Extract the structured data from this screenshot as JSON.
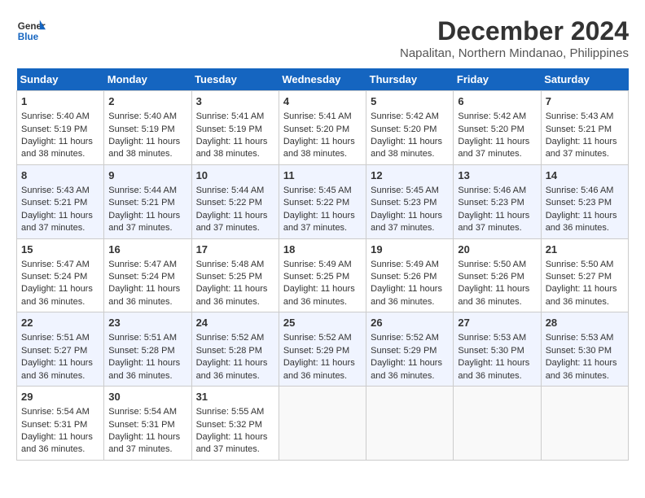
{
  "app": {
    "name": "GeneralBlue",
    "logo_text_line1": "General",
    "logo_text_line2": "Blue"
  },
  "header": {
    "month_year": "December 2024",
    "location": "Napalitan, Northern Mindanao, Philippines"
  },
  "days_of_week": [
    "Sunday",
    "Monday",
    "Tuesday",
    "Wednesday",
    "Thursday",
    "Friday",
    "Saturday"
  ],
  "weeks": [
    [
      {
        "day": "1",
        "sunrise": "Sunrise: 5:40 AM",
        "sunset": "Sunset: 5:19 PM",
        "daylight": "Daylight: 11 hours and 38 minutes."
      },
      {
        "day": "2",
        "sunrise": "Sunrise: 5:40 AM",
        "sunset": "Sunset: 5:19 PM",
        "daylight": "Daylight: 11 hours and 38 minutes."
      },
      {
        "day": "3",
        "sunrise": "Sunrise: 5:41 AM",
        "sunset": "Sunset: 5:19 PM",
        "daylight": "Daylight: 11 hours and 38 minutes."
      },
      {
        "day": "4",
        "sunrise": "Sunrise: 5:41 AM",
        "sunset": "Sunset: 5:20 PM",
        "daylight": "Daylight: 11 hours and 38 minutes."
      },
      {
        "day": "5",
        "sunrise": "Sunrise: 5:42 AM",
        "sunset": "Sunset: 5:20 PM",
        "daylight": "Daylight: 11 hours and 38 minutes."
      },
      {
        "day": "6",
        "sunrise": "Sunrise: 5:42 AM",
        "sunset": "Sunset: 5:20 PM",
        "daylight": "Daylight: 11 hours and 37 minutes."
      },
      {
        "day": "7",
        "sunrise": "Sunrise: 5:43 AM",
        "sunset": "Sunset: 5:21 PM",
        "daylight": "Daylight: 11 hours and 37 minutes."
      }
    ],
    [
      {
        "day": "8",
        "sunrise": "Sunrise: 5:43 AM",
        "sunset": "Sunset: 5:21 PM",
        "daylight": "Daylight: 11 hours and 37 minutes."
      },
      {
        "day": "9",
        "sunrise": "Sunrise: 5:44 AM",
        "sunset": "Sunset: 5:21 PM",
        "daylight": "Daylight: 11 hours and 37 minutes."
      },
      {
        "day": "10",
        "sunrise": "Sunrise: 5:44 AM",
        "sunset": "Sunset: 5:22 PM",
        "daylight": "Daylight: 11 hours and 37 minutes."
      },
      {
        "day": "11",
        "sunrise": "Sunrise: 5:45 AM",
        "sunset": "Sunset: 5:22 PM",
        "daylight": "Daylight: 11 hours and 37 minutes."
      },
      {
        "day": "12",
        "sunrise": "Sunrise: 5:45 AM",
        "sunset": "Sunset: 5:23 PM",
        "daylight": "Daylight: 11 hours and 37 minutes."
      },
      {
        "day": "13",
        "sunrise": "Sunrise: 5:46 AM",
        "sunset": "Sunset: 5:23 PM",
        "daylight": "Daylight: 11 hours and 37 minutes."
      },
      {
        "day": "14",
        "sunrise": "Sunrise: 5:46 AM",
        "sunset": "Sunset: 5:23 PM",
        "daylight": "Daylight: 11 hours and 36 minutes."
      }
    ],
    [
      {
        "day": "15",
        "sunrise": "Sunrise: 5:47 AM",
        "sunset": "Sunset: 5:24 PM",
        "daylight": "Daylight: 11 hours and 36 minutes."
      },
      {
        "day": "16",
        "sunrise": "Sunrise: 5:47 AM",
        "sunset": "Sunset: 5:24 PM",
        "daylight": "Daylight: 11 hours and 36 minutes."
      },
      {
        "day": "17",
        "sunrise": "Sunrise: 5:48 AM",
        "sunset": "Sunset: 5:25 PM",
        "daylight": "Daylight: 11 hours and 36 minutes."
      },
      {
        "day": "18",
        "sunrise": "Sunrise: 5:49 AM",
        "sunset": "Sunset: 5:25 PM",
        "daylight": "Daylight: 11 hours and 36 minutes."
      },
      {
        "day": "19",
        "sunrise": "Sunrise: 5:49 AM",
        "sunset": "Sunset: 5:26 PM",
        "daylight": "Daylight: 11 hours and 36 minutes."
      },
      {
        "day": "20",
        "sunrise": "Sunrise: 5:50 AM",
        "sunset": "Sunset: 5:26 PM",
        "daylight": "Daylight: 11 hours and 36 minutes."
      },
      {
        "day": "21",
        "sunrise": "Sunrise: 5:50 AM",
        "sunset": "Sunset: 5:27 PM",
        "daylight": "Daylight: 11 hours and 36 minutes."
      }
    ],
    [
      {
        "day": "22",
        "sunrise": "Sunrise: 5:51 AM",
        "sunset": "Sunset: 5:27 PM",
        "daylight": "Daylight: 11 hours and 36 minutes."
      },
      {
        "day": "23",
        "sunrise": "Sunrise: 5:51 AM",
        "sunset": "Sunset: 5:28 PM",
        "daylight": "Daylight: 11 hours and 36 minutes."
      },
      {
        "day": "24",
        "sunrise": "Sunrise: 5:52 AM",
        "sunset": "Sunset: 5:28 PM",
        "daylight": "Daylight: 11 hours and 36 minutes."
      },
      {
        "day": "25",
        "sunrise": "Sunrise: 5:52 AM",
        "sunset": "Sunset: 5:29 PM",
        "daylight": "Daylight: 11 hours and 36 minutes."
      },
      {
        "day": "26",
        "sunrise": "Sunrise: 5:52 AM",
        "sunset": "Sunset: 5:29 PM",
        "daylight": "Daylight: 11 hours and 36 minutes."
      },
      {
        "day": "27",
        "sunrise": "Sunrise: 5:53 AM",
        "sunset": "Sunset: 5:30 PM",
        "daylight": "Daylight: 11 hours and 36 minutes."
      },
      {
        "day": "28",
        "sunrise": "Sunrise: 5:53 AM",
        "sunset": "Sunset: 5:30 PM",
        "daylight": "Daylight: 11 hours and 36 minutes."
      }
    ],
    [
      {
        "day": "29",
        "sunrise": "Sunrise: 5:54 AM",
        "sunset": "Sunset: 5:31 PM",
        "daylight": "Daylight: 11 hours and 36 minutes."
      },
      {
        "day": "30",
        "sunrise": "Sunrise: 5:54 AM",
        "sunset": "Sunset: 5:31 PM",
        "daylight": "Daylight: 11 hours and 37 minutes."
      },
      {
        "day": "31",
        "sunrise": "Sunrise: 5:55 AM",
        "sunset": "Sunset: 5:32 PM",
        "daylight": "Daylight: 11 hours and 37 minutes."
      },
      null,
      null,
      null,
      null
    ]
  ]
}
